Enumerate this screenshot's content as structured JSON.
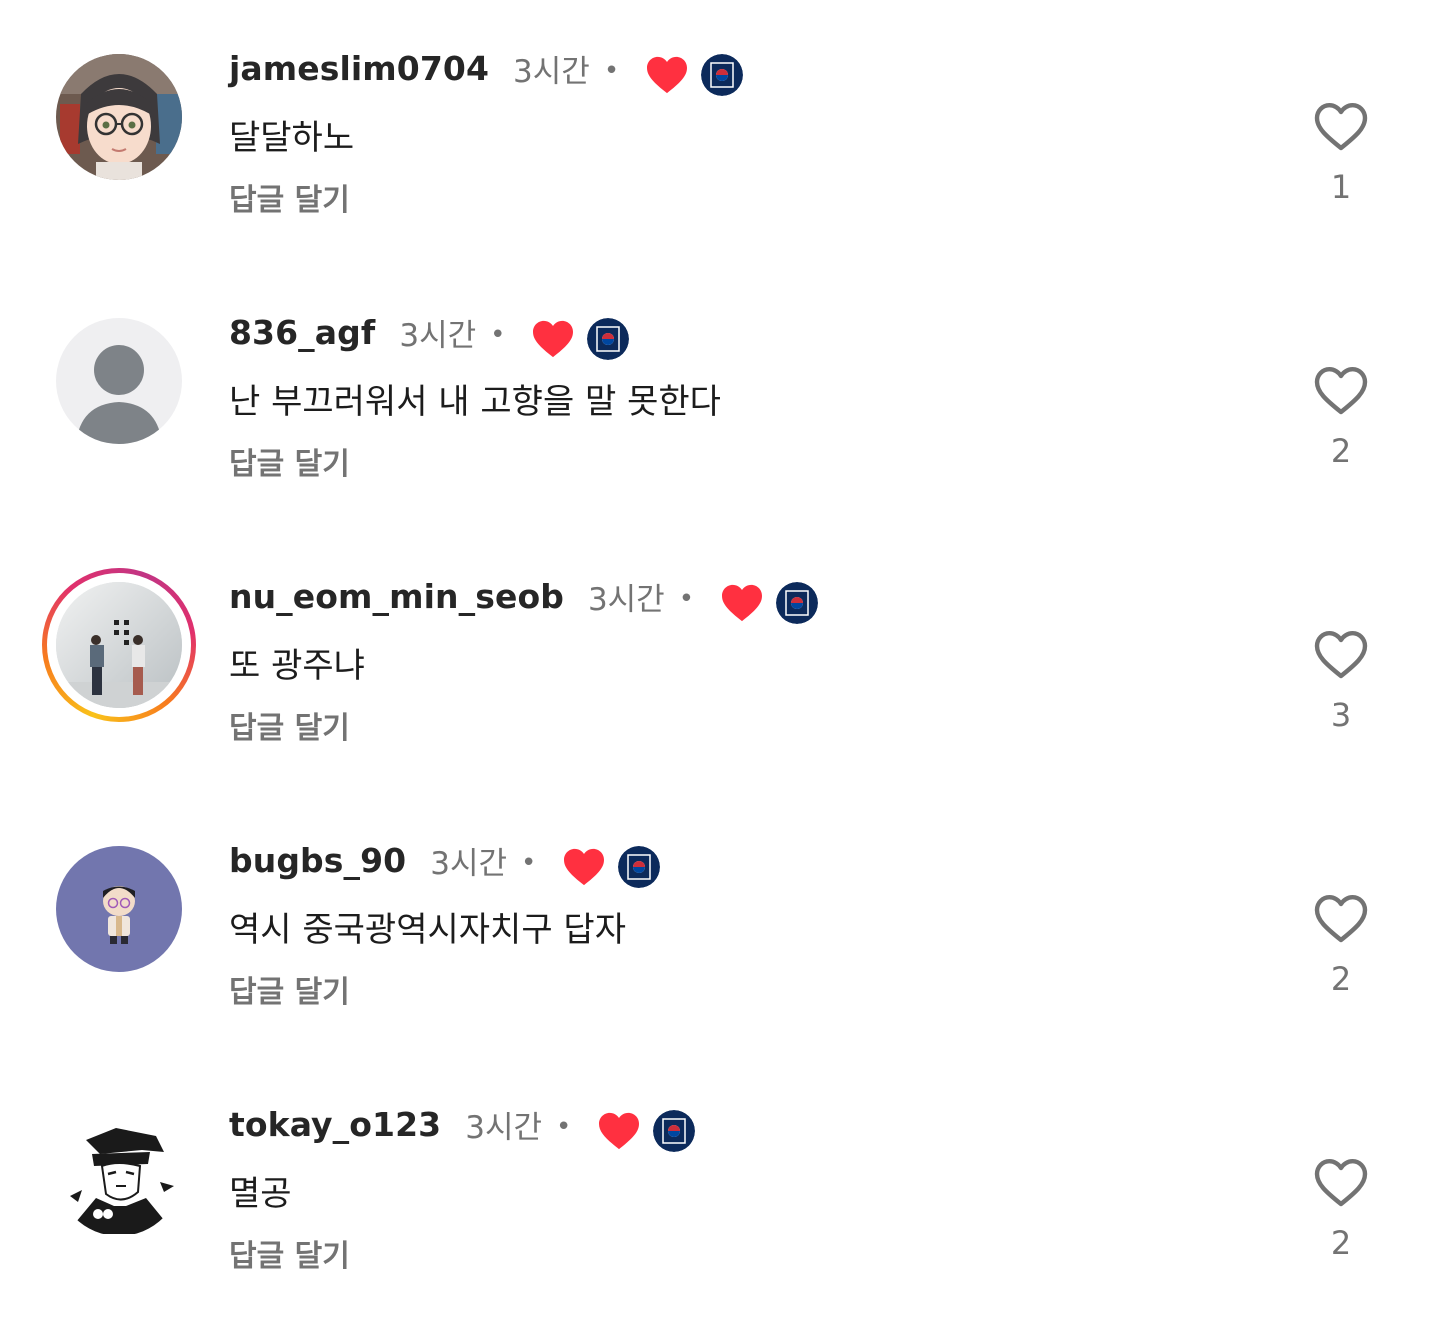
{
  "comments": [
    {
      "username": "jameslim0704",
      "time": "3시간",
      "dot": "•",
      "text": "달달하노",
      "reply": "답글 달기",
      "likes": "1",
      "avatar": "illustrated-glasses-woman",
      "story_ring": false
    },
    {
      "username": "836_agf",
      "time": "3시간",
      "dot": "•",
      "text": "난 부끄러워서 내 고향을 말 못한다",
      "reply": "답글 달기",
      "likes": "2",
      "avatar": "default-person",
      "story_ring": false
    },
    {
      "username": "nu_eom_min_seob",
      "time": "3시간",
      "dot": "•",
      "text": "또 광주냐",
      "reply": "답글 달기",
      "likes": "3",
      "avatar": "photo-two-people-white-wall",
      "story_ring": true
    },
    {
      "username": "bugbs_90",
      "time": "3시간",
      "dot": "•",
      "text": "역시 중국광역시자치구 답자",
      "reply": "답글 달기",
      "likes": "2",
      "avatar": "cartoon-boy-purple",
      "story_ring": false
    },
    {
      "username": "tokay_o123",
      "time": "3시간",
      "dot": "•",
      "text": "멸공",
      "reply": "답글 달기",
      "likes": "2",
      "avatar": "manga-character-cap",
      "story_ring": false
    }
  ],
  "colors": {
    "author_heart": "#ff3040",
    "badge": "#0c2a5b",
    "muted": "#737373",
    "story_ring": [
      "#f9c21a",
      "#e1306c",
      "#c13584"
    ]
  },
  "icons": {
    "author_heart": "heart-filled-icon",
    "author_badge": "author-profile-badge",
    "like": "heart-outline-icon"
  }
}
